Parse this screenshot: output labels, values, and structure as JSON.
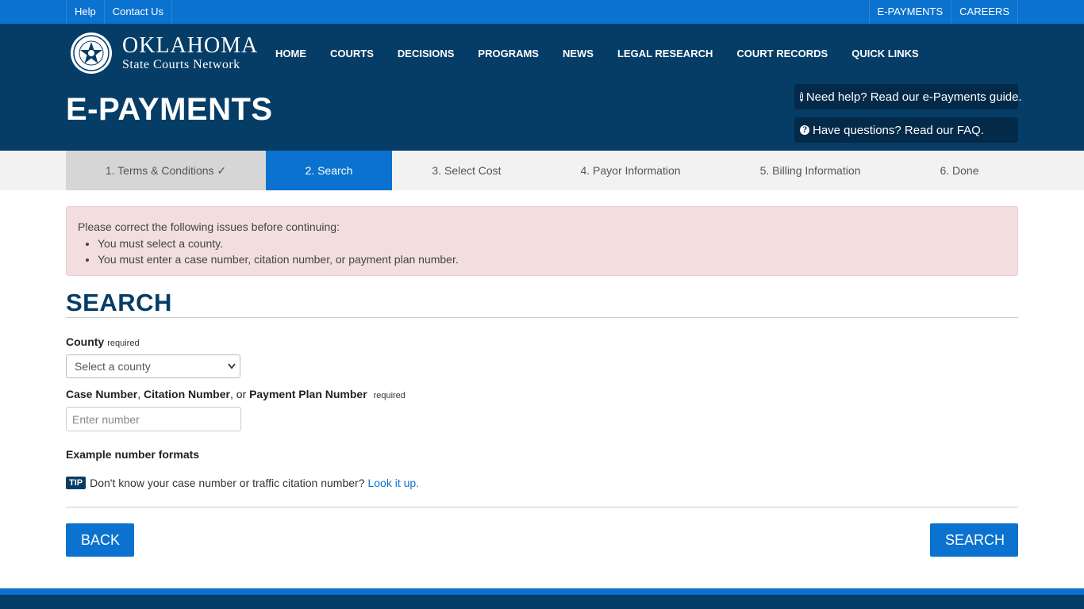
{
  "utility": {
    "left": [
      {
        "label": "Help"
      },
      {
        "label": "Contact Us"
      }
    ],
    "right": [
      {
        "label": "E-PAYMENTS"
      },
      {
        "label": "CAREERS"
      }
    ]
  },
  "logo": {
    "title": "OKLAHOMA",
    "subtitle": "State Courts Network"
  },
  "nav": [
    {
      "label": "HOME"
    },
    {
      "label": "COURTS"
    },
    {
      "label": "DECISIONS"
    },
    {
      "label": "PROGRAMS"
    },
    {
      "label": "NEWS"
    },
    {
      "label": "LEGAL RESEARCH"
    },
    {
      "label": "COURT RECORDS"
    },
    {
      "label": "QUICK LINKS"
    }
  ],
  "page_title": "E-PAYMENTS",
  "help": {
    "guide": "Need help? Read our e-Payments guide.",
    "faq": "Have questions? Read our FAQ."
  },
  "steps": [
    {
      "label": "1. Terms & Conditions ✓",
      "state": "done"
    },
    {
      "label": "2. Search",
      "state": "active"
    },
    {
      "label": "3. Select Cost",
      "state": "pending"
    },
    {
      "label": "4. Payor Information",
      "state": "pending"
    },
    {
      "label": "5. Billing Information",
      "state": "pending"
    },
    {
      "label": "6. Done",
      "state": "pending"
    }
  ],
  "alert": {
    "intro": "Please correct the following issues before continuing:",
    "errors": [
      "You must select a county.",
      "You must enter a case number, citation number, or payment plan number."
    ]
  },
  "search": {
    "title": "SEARCH",
    "county_label": "County",
    "required": "required",
    "county_value": "Select a county",
    "number_label_1": "Case Number",
    "sep_1": ", ",
    "number_label_2": "Citation Number",
    "sep_2": ", or ",
    "number_label_3": "Payment Plan Number",
    "number_placeholder": "Enter number",
    "example": "Example number formats",
    "tip_badge": "TIP",
    "tip_text": "Don't know your case number or traffic citation number?",
    "tip_link": "Look it up."
  },
  "buttons": {
    "back": "BACK",
    "search": "SEARCH"
  },
  "colors": {
    "primary": "#0b72cf",
    "dark": "#053d67",
    "alert_bg": "#f2dede"
  }
}
